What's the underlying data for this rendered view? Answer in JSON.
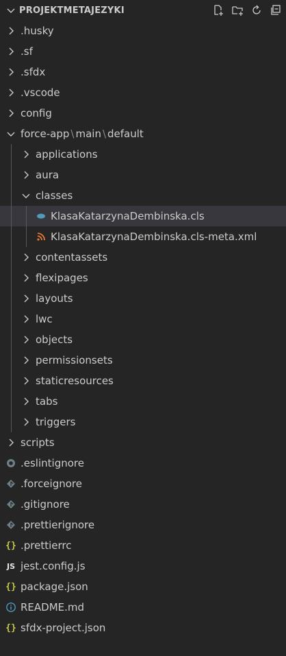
{
  "explorer": {
    "title": "PROJEKTMETAJEZYKI",
    "actions": [
      "new-file-icon",
      "new-folder-icon",
      "refresh-icon",
      "collapse-all-icon"
    ]
  },
  "tree": [
    {
      "name": ".husky",
      "type": "folder",
      "depth": 1,
      "expanded": false
    },
    {
      "name": ".sf",
      "type": "folder",
      "depth": 1,
      "expanded": false
    },
    {
      "name": ".sfdx",
      "type": "folder",
      "depth": 1,
      "expanded": false
    },
    {
      "name": ".vscode",
      "type": "folder",
      "depth": 1,
      "expanded": false
    },
    {
      "name": "config",
      "type": "folder",
      "depth": 1,
      "expanded": false
    },
    {
      "name": "force-app",
      "path": [
        "force-app",
        "main",
        "default"
      ],
      "type": "folder",
      "depth": 1,
      "expanded": true
    },
    {
      "name": "applications",
      "type": "folder",
      "depth": 2,
      "expanded": false
    },
    {
      "name": "aura",
      "type": "folder",
      "depth": 2,
      "expanded": false
    },
    {
      "name": "classes",
      "type": "folder",
      "depth": 2,
      "expanded": true
    },
    {
      "name": "KlasaKatarzynaDembinska.cls",
      "type": "file",
      "icon": "apex-class-icon",
      "depth": 3,
      "selected": true
    },
    {
      "name": "KlasaKatarzynaDembinska.cls-meta.xml",
      "type": "file",
      "icon": "xml-rss-icon",
      "depth": 3
    },
    {
      "name": "contentassets",
      "type": "folder",
      "depth": 2,
      "expanded": false
    },
    {
      "name": "flexipages",
      "type": "folder",
      "depth": 2,
      "expanded": false
    },
    {
      "name": "layouts",
      "type": "folder",
      "depth": 2,
      "expanded": false
    },
    {
      "name": "lwc",
      "type": "folder",
      "depth": 2,
      "expanded": false
    },
    {
      "name": "objects",
      "type": "folder",
      "depth": 2,
      "expanded": false
    },
    {
      "name": "permissionsets",
      "type": "folder",
      "depth": 2,
      "expanded": false
    },
    {
      "name": "staticresources",
      "type": "folder",
      "depth": 2,
      "expanded": false
    },
    {
      "name": "tabs",
      "type": "folder",
      "depth": 2,
      "expanded": false
    },
    {
      "name": "triggers",
      "type": "folder",
      "depth": 2,
      "expanded": false
    },
    {
      "name": "scripts",
      "type": "folder",
      "depth": 1,
      "expanded": false
    },
    {
      "name": ".eslintignore",
      "type": "file",
      "icon": "eslint-icon",
      "depth": 1
    },
    {
      "name": ".forceignore",
      "type": "file",
      "icon": "diamond-icon",
      "depth": 1
    },
    {
      "name": ".gitignore",
      "type": "file",
      "icon": "diamond-icon",
      "depth": 1
    },
    {
      "name": ".prettierignore",
      "type": "file",
      "icon": "diamond-icon",
      "depth": 1
    },
    {
      "name": ".prettierrc",
      "type": "file",
      "icon": "json-braces-icon",
      "depth": 1
    },
    {
      "name": "jest.config.js",
      "type": "file",
      "icon": "js-icon",
      "depth": 1
    },
    {
      "name": "package.json",
      "type": "file",
      "icon": "json-braces-icon",
      "depth": 1
    },
    {
      "name": "README.md",
      "type": "file",
      "icon": "info-icon",
      "depth": 1
    },
    {
      "name": "sfdx-project.json",
      "type": "file",
      "icon": "json-braces-icon",
      "depth": 1
    }
  ],
  "colors": {
    "background": "#252526",
    "selected_row": "#37373d",
    "text": "#cccccc",
    "apex_icon": "#519aba",
    "xml_icon": "#e37933",
    "json_icon": "#cbcb41",
    "muted_icon": "#6d8086"
  }
}
